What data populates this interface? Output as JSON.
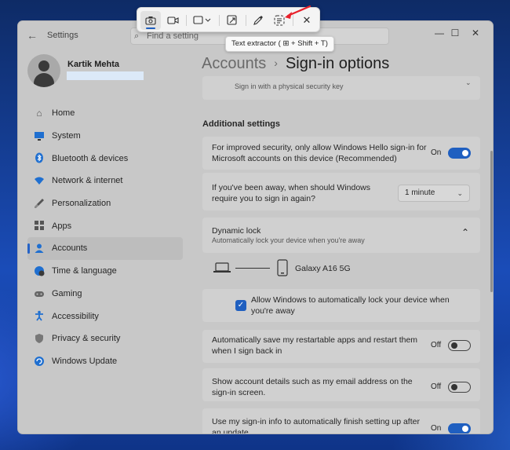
{
  "app": {
    "title": "Settings",
    "search_placeholder": "Find a setting"
  },
  "profile": {
    "name": "Kartik Mehta"
  },
  "sidebar": {
    "items": [
      {
        "label": "Home",
        "icon": "home-icon",
        "active": false
      },
      {
        "label": "System",
        "icon": "monitor-icon",
        "active": false
      },
      {
        "label": "Bluetooth & devices",
        "icon": "bluetooth-icon",
        "active": false
      },
      {
        "label": "Network & internet",
        "icon": "wifi-icon",
        "active": false
      },
      {
        "label": "Personalization",
        "icon": "brush-icon",
        "active": false
      },
      {
        "label": "Apps",
        "icon": "apps-icon",
        "active": false
      },
      {
        "label": "Accounts",
        "icon": "person-icon",
        "active": true
      },
      {
        "label": "Time & language",
        "icon": "globe-clock-icon",
        "active": false
      },
      {
        "label": "Gaming",
        "icon": "gamepad-icon",
        "active": false
      },
      {
        "label": "Accessibility",
        "icon": "accessibility-icon",
        "active": false
      },
      {
        "label": "Privacy & security",
        "icon": "shield-icon",
        "active": false
      },
      {
        "label": "Windows Update",
        "icon": "update-icon",
        "active": false
      }
    ]
  },
  "main": {
    "breadcrumb_parent": "Accounts",
    "breadcrumb_separator": "›",
    "page_title": "Sign-in options",
    "security_key_sub": "Sign in with a physical security key",
    "additional_settings_title": "Additional settings",
    "hello_only": {
      "text": "For improved security, only allow Windows Hello sign-in for Microsoft accounts on this device (Recommended)",
      "state": "On"
    },
    "away": {
      "text": "If you've been away, when should Windows require you to sign in again?",
      "value": "1 minute"
    },
    "dynamic_lock": {
      "title": "Dynamic lock",
      "subtitle": "Automatically lock your device when you're away",
      "device": "Galaxy A16 5G",
      "checkbox_label": "Allow Windows to automatically lock your device when you're away",
      "checked": true
    },
    "restart_apps": {
      "text": "Automatically save my restartable apps and restart them when I sign back in",
      "state": "Off"
    },
    "account_details": {
      "text": "Show account details such as my email address on the sign-in screen.",
      "state": "Off"
    },
    "signin_info": {
      "text": "Use my sign-in info to automatically finish setting up after an update",
      "state": "On"
    }
  },
  "snip_toolbar": {
    "tooltip": "Text extractor ( ⊞ + Shift + T)",
    "buttons": [
      {
        "name": "screenshot-mode-button",
        "icon": "camera-icon",
        "selected": true
      },
      {
        "name": "video-mode-button",
        "icon": "video-icon",
        "selected": false
      },
      {
        "name": "snip-shape-button",
        "icon": "rectangle-snip-icon",
        "selected": false
      },
      {
        "name": "window-snip-button",
        "icon": "window-snip-icon",
        "selected": false
      },
      {
        "name": "color-picker-button",
        "icon": "eyedropper-icon",
        "selected": false
      },
      {
        "name": "text-extractor-button",
        "icon": "text-extractor-icon",
        "selected": false
      },
      {
        "name": "close-toolbar-button",
        "icon": "close-icon",
        "selected": false
      }
    ],
    "annotation_arrow_color": "#e8202a"
  },
  "colors": {
    "accent": "#1f5fc0"
  }
}
